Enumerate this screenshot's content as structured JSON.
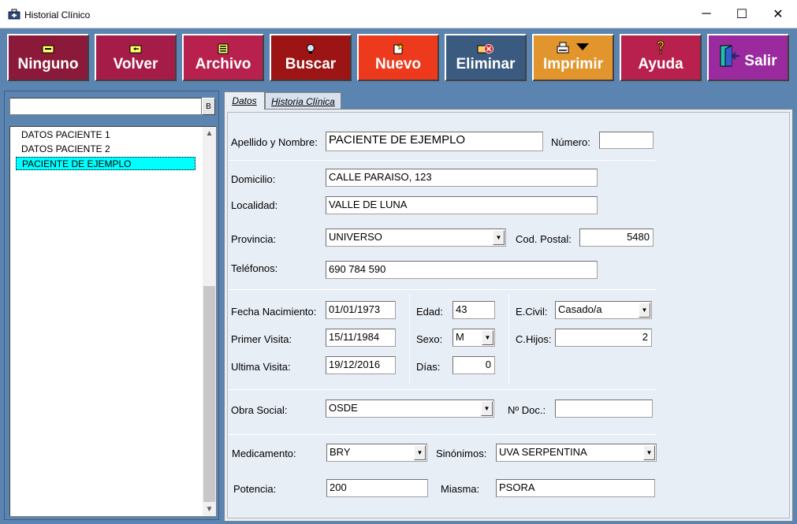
{
  "window": {
    "title": "Historial Clínico",
    "minimize": "─",
    "maximize": "☐",
    "close": "✕"
  },
  "toolbar": {
    "buttons": [
      {
        "label": "Ninguno",
        "color": "#8b1a3a"
      },
      {
        "label": "Volver",
        "color": "#a61c48"
      },
      {
        "label": "Archivo",
        "color": "#b8204e"
      },
      {
        "label": "Buscar",
        "color": "#9c1414"
      },
      {
        "label": "Nuevo",
        "color": "#ee3a1c"
      },
      {
        "label": "Eliminar",
        "color": "#3a5a80"
      },
      {
        "label": "Imprimir",
        "color": "#e2952c"
      },
      {
        "label": "Ayuda",
        "color": "#b8204e"
      },
      {
        "label": "Salir",
        "color": "#9a2a9e"
      }
    ]
  },
  "left": {
    "search_value": "",
    "search_button": "B",
    "patients": [
      "DATOS PACIENTE 1",
      "DATOS PACIENTE 2",
      "PACIENTE DE EJEMPLO"
    ],
    "selected_index": 2
  },
  "tabs": [
    "Datos",
    "Historia Clínica"
  ],
  "form": {
    "nombre_label": "Apellido y Nombre:",
    "nombre": "PACIENTE DE EJEMPLO",
    "numero_label": "Número:",
    "numero": "",
    "domicilio_label": "Domicilio:",
    "domicilio": "CALLE PARAISO, 123",
    "localidad_label": "Localidad:",
    "localidad": "VALLE DE LUNA",
    "provincia_label": "Provincia:",
    "provincia": "UNIVERSO",
    "cp_label": "Cod. Postal:",
    "cp": "5480",
    "telefonos_label": "Teléfonos:",
    "telefonos": "690 784 590",
    "fnac_label": "Fecha Nacimiento:",
    "fnac": "01/01/1973",
    "edad_label": "Edad:",
    "edad": "43",
    "ecivil_label": "E.Civil:",
    "ecivil": "Casado/a",
    "pvisita_label": "Primer Visita:",
    "pvisita": "15/11/1984",
    "sexo_label": "Sexo:",
    "sexo": "M",
    "chijos_label": "C.Hijos:",
    "chijos": "2",
    "uvisita_label": "Ultima Visita:",
    "uvisita": "19/12/2016",
    "dias_label": "Días:",
    "dias": "0",
    "obra_label": "Obra Social:",
    "obra": "OSDE",
    "ndoc_label": "Nº Doc.:",
    "ndoc": "",
    "medicamento_label": "Medicamento:",
    "medicamento": "BRY",
    "sinonimos_label": "Sinónimos:",
    "sinonimos": "UVA SERPENTINA",
    "potencia_label": "Potencia:",
    "potencia": "200",
    "miasma_label": "Miasma:",
    "miasma": "PSORA"
  }
}
